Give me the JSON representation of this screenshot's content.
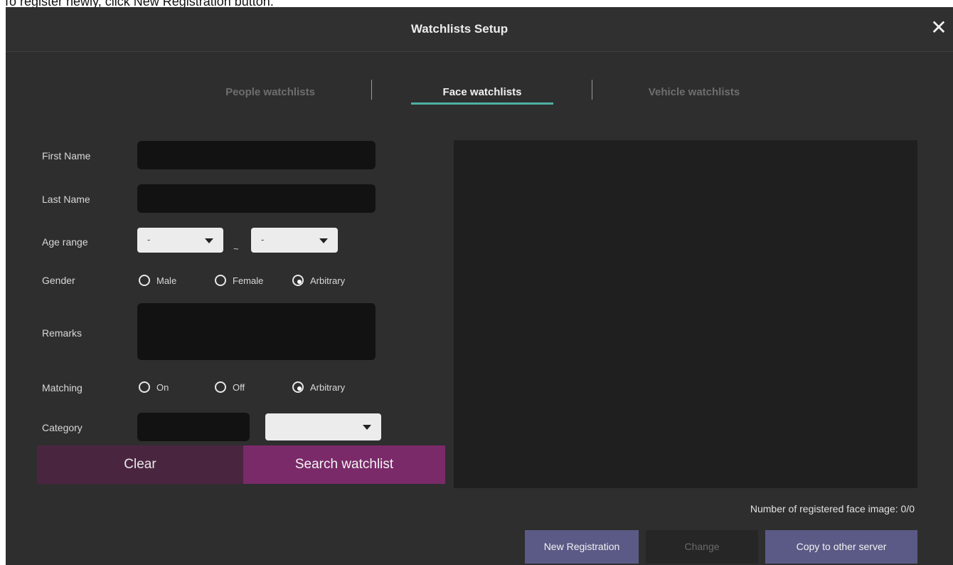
{
  "instruction": "To register newly, click New Registration button.",
  "dialog": {
    "title": "Watchlists Setup",
    "close": "✕"
  },
  "tabs": [
    {
      "label": "People watchlists",
      "active": false
    },
    {
      "label": "Face watchlists",
      "active": true
    },
    {
      "label": "Vehicle watchlists",
      "active": false
    }
  ],
  "form": {
    "first_name": {
      "label": "First Name",
      "value": ""
    },
    "last_name": {
      "label": "Last Name",
      "value": ""
    },
    "age_range": {
      "label": "Age range",
      "from": "-",
      "to": "-",
      "separator": "~"
    },
    "gender": {
      "label": "Gender",
      "options": [
        "Male",
        "Female",
        "Arbitrary"
      ],
      "selected": "Arbitrary"
    },
    "remarks": {
      "label": "Remarks",
      "value": ""
    },
    "matching": {
      "label": "Matching",
      "options": [
        "On",
        "Off",
        "Arbitrary"
      ],
      "selected": "Arbitrary"
    },
    "category": {
      "label": "Category",
      "value": "",
      "select_value": ""
    }
  },
  "buttons": {
    "clear": "Clear",
    "search": "Search watchlist",
    "new_registration": "New Registration",
    "change": "Change",
    "copy": "Copy to other server"
  },
  "status": {
    "registered_count": "Number of registered face image: 0/0"
  },
  "colors": {
    "background": "#2e2e2e",
    "tab_accent": "#4fb0a3",
    "search_button": "#7a2a69",
    "clear_button": "#4a2540",
    "action_button": "#5b5a86"
  }
}
